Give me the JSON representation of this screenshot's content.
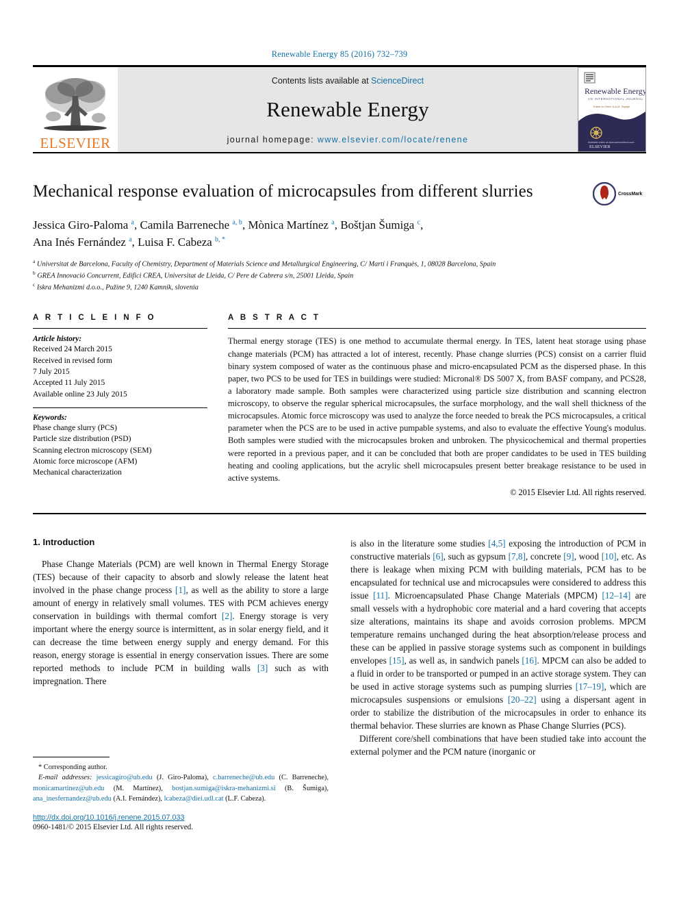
{
  "running_head": "Renewable Energy 85 (2016) 732–739",
  "masthead": {
    "publisher_logo_text": "ELSEVIER",
    "contents_prefix": "Contents lists available at ",
    "contents_link": "ScienceDirect",
    "journal_title": "Renewable Energy",
    "homepage_prefix": "journal homepage: ",
    "homepage_link": "www.elsevier.com/locate/renene",
    "cover": {
      "title": "Renewable Energy",
      "subtitle": "AN INTERNATIONAL JOURNAL",
      "editor_line": "Editor-in-Chief: A.A.M. Sayigh",
      "bottom_brand": "ELSEVIER"
    }
  },
  "article": {
    "title": "Mechanical response evaluation of microcapsules from different slurries",
    "crossmark_label": "CrossMark",
    "authors_line_1": "Jessica Giro-Paloma <sup>a</sup>, Camila Barreneche <sup>a, b</sup>, Mònica Martínez <sup>a</sup>, Boštjan Šumiga <sup>c</sup>,",
    "authors_line_2": "Ana Inés Fernández <sup>a</sup>, Luisa F. Cabeza <sup>b, *</sup>",
    "affiliations": [
      "<sup>a</sup> Universitat de Barcelona, Faculty of Chemistry, Department of Materials Science and Metallurgical Engineering, C/ Martí i Franquès, 1, 08028 Barcelona, Spain",
      "<sup>b</sup> GREA Innovació Concurrent, Edifici CREA, Universitat de Lleida, C/ Pere de Cabrera s/n, 25001 Lleida, Spain",
      "<sup>c</sup> Iskra Mehanizmi d.o.o., Pužine 9, 1240 Kamnik, slovenia"
    ]
  },
  "article_info": {
    "heading": "A R T I C L E   I N F O",
    "history_label": "Article history:",
    "history_lines": [
      "Received 24 March 2015",
      "Received in revised form",
      "7 July 2015",
      "Accepted 11 July 2015",
      "Available online 23 July 2015"
    ],
    "keywords_label": "Keywords:",
    "keywords": [
      "Phase change slurry (PCS)",
      "Particle size distribution (PSD)",
      "Scanning electron microscopy (SEM)",
      "Atomic force microscope (AFM)",
      "Mechanical characterization"
    ]
  },
  "abstract": {
    "heading": "A B S T R A C T",
    "text": "Thermal energy storage (TES) is one method to accumulate thermal energy. In TES, latent heat storage using phase change materials (PCM) has attracted a lot of interest, recently. Phase change slurries (PCS) consist on a carrier fluid binary system composed of water as the continuous phase and micro-encapsulated PCM as the dispersed phase. In this paper, two PCS to be used for TES in buildings were studied: Micronal® DS 5007 X, from BASF company, and PCS28, a laboratory made sample. Both samples were characterized using particle size distribution and scanning electron microscopy, to observe the regular spherical microcapsules, the surface morphology, and the wall shell thickness of the microcapsules. Atomic force microscopy was used to analyze the force needed to break the PCS microcapsules, a critical parameter when the PCS are to be used in active pumpable systems, and also to evaluate the effective Young's modulus. Both samples were studied with the microcapsules broken and unbroken. The physicochemical and thermal properties were reported in a previous paper, and it can be concluded that both are proper candidates to be used in TES building heating and cooling applications, but the acrylic shell microcapsules present better breakage resistance to be used in active systems.",
    "copyright": "© 2015 Elsevier Ltd. All rights reserved."
  },
  "introduction": {
    "heading": "1. Introduction",
    "left_paragraph": "Phase Change Materials (PCM) are well known in Thermal Energy Storage (TES) because of their capacity to absorb and slowly release the latent heat involved in the phase change process [1], as well as the ability to store a large amount of energy in relatively small volumes. TES with PCM achieves energy conservation in buildings with thermal comfort [2]. Energy storage is very important where the energy source is intermittent, as in solar energy field, and it can decrease the time between energy supply and energy demand. For this reason, energy storage is essential in energy conservation issues. There are some reported methods to include PCM in building walls [3] such as with impregnation. There",
    "right_paragraph_cont": "is also in the literature some studies [4,5] exposing the introduction of PCM in constructive materials [6], such as gypsum [7,8], concrete [9], wood [10], etc. As there is leakage when mixing PCM with building materials, PCM has to be encapsulated for technical use and microcapsules were considered to address this issue [11]. Microencapsulated Phase Change Materials (MPCM) [12–14] are small vessels with a hydrophobic core material and a hard covering that accepts size alterations, maintains its shape and avoids corrosion problems. MPCM temperature remains unchanged during the heat absorption/release process and these can be applied in passive storage systems such as component in buildings envelopes [15], as well as, in sandwich panels [16]. MPCM can also be added to a fluid in order to be transported or pumped in an active storage system. They can be used in active storage systems such as pumping slurries [17–19], which are microcapsules suspensions or emulsions [20–22] using a dispersant agent in order to stabilize the distribution of the microcapsules in order to enhance its thermal behavior. These slurries are known as Phase Change Slurries (PCS).",
    "right_paragraph_2": "Different core/shell combinations that have been studied take into account the external polymer and the PCM nature (inorganic or"
  },
  "footnote": {
    "corresponding": "* Corresponding author.",
    "email_label": "E-mail addresses:",
    "emails_html": "<em>E-mail addresses:</em> <a href=\"#\">jessicagiro@ub.edu</a> (J. Giro-Paloma), <a href=\"#\">c.barreneche@ub.edu</a> (C. Barreneche), <a href=\"#\">monicamartinez@ub.edu</a> (M. Martínez), <a href=\"#\">bostjan.sumiga@iskra-mehanizmi.si</a> (B. Šumiga), <a href=\"#\">ana_inesfernandez@ub.edu</a> (A.I. Fernández), <a href=\"#\">lcabeza@diei.udl.cat</a> (L.F. Cabeza).",
    "doi": "http://dx.doi.org/10.1016/j.renene.2015.07.033",
    "issn": "0960-1481/© 2015 Elsevier Ltd. All rights reserved."
  },
  "colors": {
    "link": "#1371a8",
    "elsevier_orange": "#e87722",
    "band_gray": "#e6e6e6",
    "cover_navy": "#2d2a55",
    "crossmark_red": "#b02418"
  }
}
